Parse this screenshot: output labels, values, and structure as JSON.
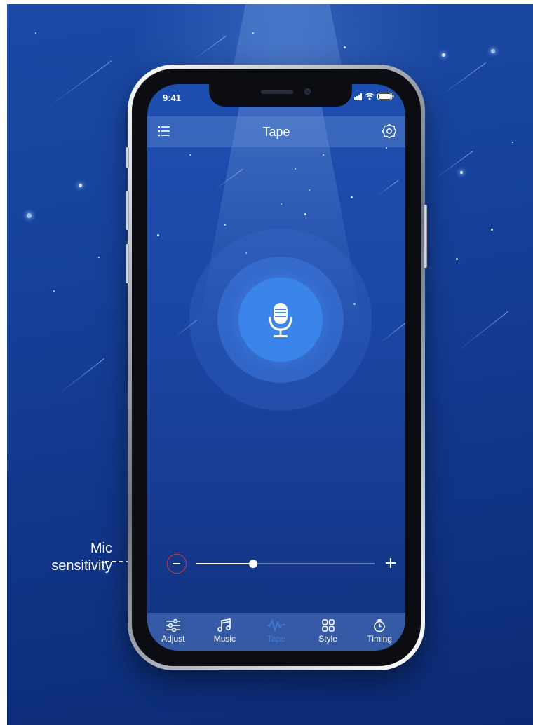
{
  "status_bar": {
    "time": "9:41"
  },
  "header": {
    "title": "Tape",
    "menu_icon": "list-menu-icon",
    "settings_icon": "gear-icon"
  },
  "recorder": {
    "icon": "microphone-icon",
    "accent_color": "#3a84ea"
  },
  "sensitivity": {
    "minus_icon": "minus-icon",
    "plus_icon": "plus-icon",
    "level": 0.32,
    "minus_highlight_color": "#d43a3a"
  },
  "annotation": {
    "line1": "Mic",
    "line2": "sensitivity"
  },
  "bottom_nav": {
    "items": [
      {
        "label": "Adjust",
        "icon": "sliders-icon"
      },
      {
        "label": "Music",
        "icon": "music-note-icon"
      },
      {
        "label": "Tape",
        "icon": "tape-wave-icon",
        "active": true
      },
      {
        "label": "Style",
        "icon": "grid-icon"
      },
      {
        "label": "Timing",
        "icon": "timer-icon"
      }
    ],
    "active_color": "#3f78d8"
  }
}
